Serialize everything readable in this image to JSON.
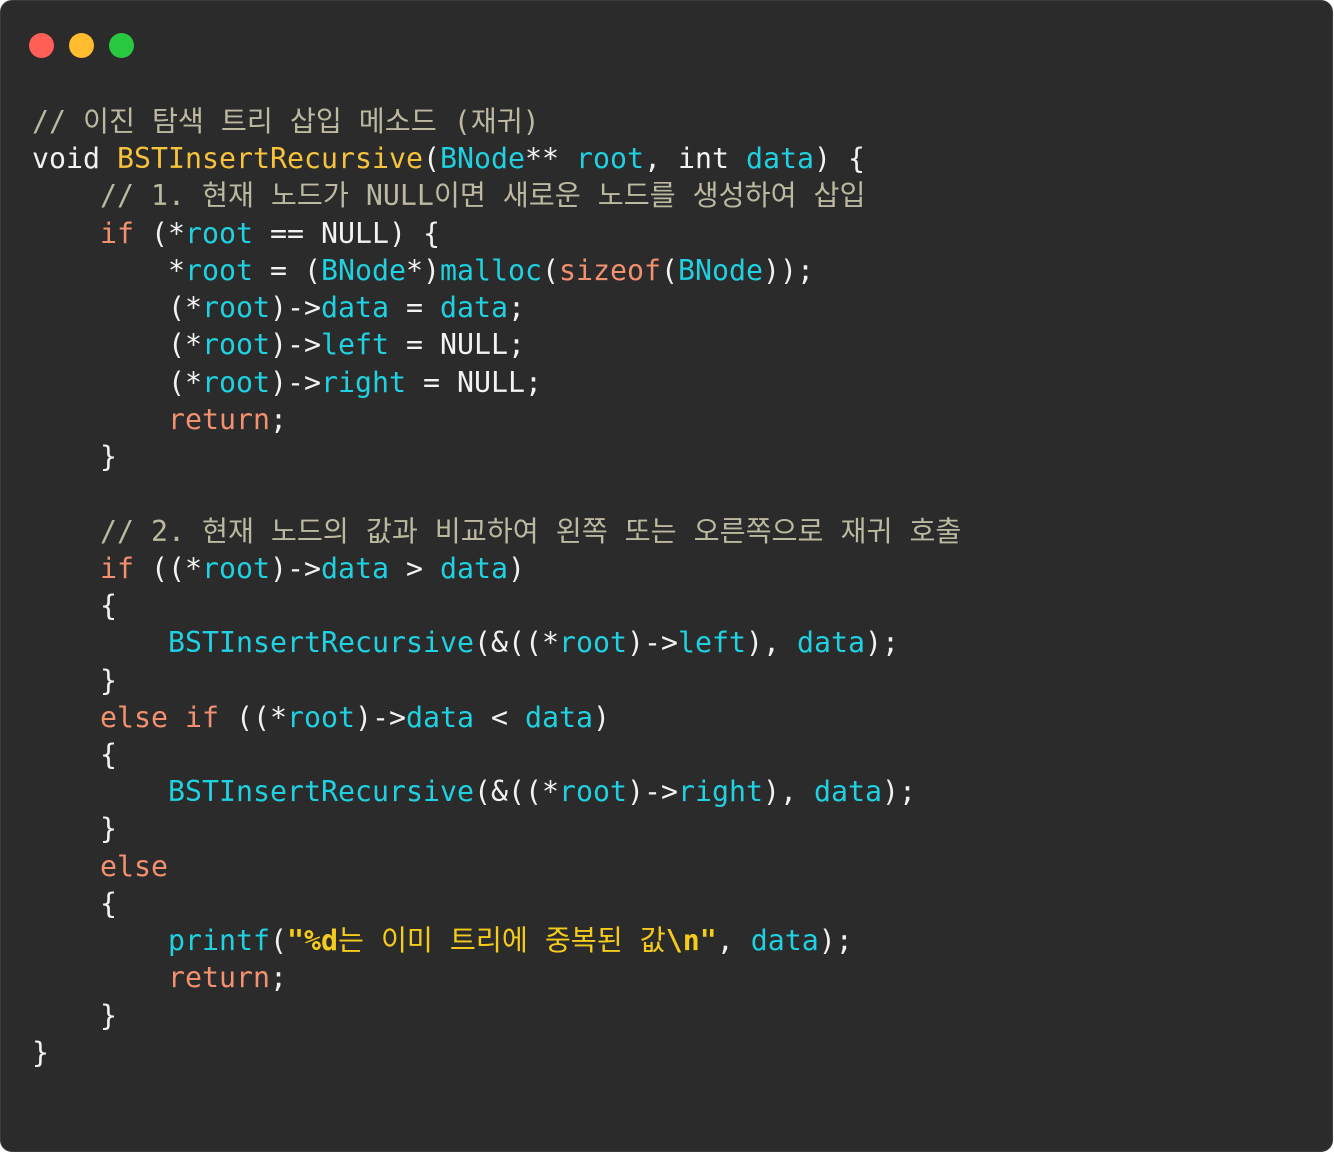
{
  "window": {
    "background": "#2b2b2b",
    "traffic_lights": {
      "close": "#ff5f57",
      "minimize": "#febc2e",
      "zoom": "#28c840"
    }
  },
  "theme": {
    "syntax": {
      "plain": "#f2f2f2",
      "comment": "#bcb9a0",
      "keyword": "#f2906f",
      "function-declaration": "#f7c23c",
      "identifier": "#1fd1e1",
      "string": "#f6cc1c"
    }
  },
  "code": {
    "lines": [
      {
        "tokens": [
          {
            "text": "// 이진 탐색 트리 삽입 메소드 (재귀)",
            "color": "#bcb9a0"
          }
        ]
      },
      {
        "tokens": [
          {
            "text": "void ",
            "color": "#f2f2f2"
          },
          {
            "text": "BSTInsertRecursive",
            "color": "#f7c23c"
          },
          {
            "text": "(",
            "color": "#f2f2f2"
          },
          {
            "text": "BNode",
            "color": "#1fd1e1"
          },
          {
            "text": "** ",
            "color": "#f2f2f2"
          },
          {
            "text": "root",
            "color": "#1fd1e1"
          },
          {
            "text": ", int ",
            "color": "#f2f2f2"
          },
          {
            "text": "data",
            "color": "#1fd1e1"
          },
          {
            "text": ") {",
            "color": "#f2f2f2"
          }
        ]
      },
      {
        "tokens": [
          {
            "text": "    // 1. 현재 노드가 NULL이면 새로운 노드를 생성하여 삽입",
            "color": "#bcb9a0"
          }
        ]
      },
      {
        "tokens": [
          {
            "text": "    if",
            "color": "#f2906f"
          },
          {
            "text": " (*",
            "color": "#f2f2f2"
          },
          {
            "text": "root",
            "color": "#1fd1e1"
          },
          {
            "text": " == NULL) {",
            "color": "#f2f2f2"
          }
        ]
      },
      {
        "tokens": [
          {
            "text": "        *",
            "color": "#f2f2f2"
          },
          {
            "text": "root",
            "color": "#1fd1e1"
          },
          {
            "text": " = (",
            "color": "#f2f2f2"
          },
          {
            "text": "BNode",
            "color": "#1fd1e1"
          },
          {
            "text": "*)",
            "color": "#f2f2f2"
          },
          {
            "text": "malloc",
            "color": "#1fd1e1"
          },
          {
            "text": "(",
            "color": "#f2f2f2"
          },
          {
            "text": "sizeof",
            "color": "#f2906f"
          },
          {
            "text": "(",
            "color": "#f2f2f2"
          },
          {
            "text": "BNode",
            "color": "#1fd1e1"
          },
          {
            "text": "));",
            "color": "#f2f2f2"
          }
        ]
      },
      {
        "tokens": [
          {
            "text": "        (*",
            "color": "#f2f2f2"
          },
          {
            "text": "root",
            "color": "#1fd1e1"
          },
          {
            "text": ")->",
            "color": "#f2f2f2"
          },
          {
            "text": "data",
            "color": "#1fd1e1"
          },
          {
            "text": " = ",
            "color": "#f2f2f2"
          },
          {
            "text": "data",
            "color": "#1fd1e1"
          },
          {
            "text": ";",
            "color": "#f2f2f2"
          }
        ]
      },
      {
        "tokens": [
          {
            "text": "        (*",
            "color": "#f2f2f2"
          },
          {
            "text": "root",
            "color": "#1fd1e1"
          },
          {
            "text": ")->",
            "color": "#f2f2f2"
          },
          {
            "text": "left",
            "color": "#1fd1e1"
          },
          {
            "text": " = NULL;",
            "color": "#f2f2f2"
          }
        ]
      },
      {
        "tokens": [
          {
            "text": "        (*",
            "color": "#f2f2f2"
          },
          {
            "text": "root",
            "color": "#1fd1e1"
          },
          {
            "text": ")->",
            "color": "#f2f2f2"
          },
          {
            "text": "right",
            "color": "#1fd1e1"
          },
          {
            "text": " = NULL;",
            "color": "#f2f2f2"
          }
        ]
      },
      {
        "tokens": [
          {
            "text": "        return",
            "color": "#f2906f"
          },
          {
            "text": ";",
            "color": "#f2f2f2"
          }
        ]
      },
      {
        "tokens": [
          {
            "text": "    }",
            "color": "#f2f2f2"
          }
        ]
      },
      {
        "tokens": []
      },
      {
        "tokens": [
          {
            "text": "    // 2. 현재 노드의 값과 비교하여 왼쪽 또는 오른쪽으로 재귀 호출",
            "color": "#bcb9a0"
          }
        ]
      },
      {
        "tokens": [
          {
            "text": "    if",
            "color": "#f2906f"
          },
          {
            "text": " ((*",
            "color": "#f2f2f2"
          },
          {
            "text": "root",
            "color": "#1fd1e1"
          },
          {
            "text": ")->",
            "color": "#f2f2f2"
          },
          {
            "text": "data",
            "color": "#1fd1e1"
          },
          {
            "text": " > ",
            "color": "#f2f2f2"
          },
          {
            "text": "data",
            "color": "#1fd1e1"
          },
          {
            "text": ")",
            "color": "#f2f2f2"
          }
        ]
      },
      {
        "tokens": [
          {
            "text": "    {",
            "color": "#f2f2f2"
          }
        ]
      },
      {
        "tokens": [
          {
            "text": "        BSTInsertRecursive",
            "color": "#1fd1e1"
          },
          {
            "text": "(&((*",
            "color": "#f2f2f2"
          },
          {
            "text": "root",
            "color": "#1fd1e1"
          },
          {
            "text": ")->",
            "color": "#f2f2f2"
          },
          {
            "text": "left",
            "color": "#1fd1e1"
          },
          {
            "text": "), ",
            "color": "#f2f2f2"
          },
          {
            "text": "data",
            "color": "#1fd1e1"
          },
          {
            "text": ");",
            "color": "#f2f2f2"
          }
        ]
      },
      {
        "tokens": [
          {
            "text": "    }",
            "color": "#f2f2f2"
          }
        ]
      },
      {
        "tokens": [
          {
            "text": "    else if",
            "color": "#f2906f"
          },
          {
            "text": " ((*",
            "color": "#f2f2f2"
          },
          {
            "text": "root",
            "color": "#1fd1e1"
          },
          {
            "text": ")->",
            "color": "#f2f2f2"
          },
          {
            "text": "data",
            "color": "#1fd1e1"
          },
          {
            "text": " < ",
            "color": "#f2f2f2"
          },
          {
            "text": "data",
            "color": "#1fd1e1"
          },
          {
            "text": ")",
            "color": "#f2f2f2"
          }
        ]
      },
      {
        "tokens": [
          {
            "text": "    {",
            "color": "#f2f2f2"
          }
        ]
      },
      {
        "tokens": [
          {
            "text": "        BSTInsertRecursive",
            "color": "#1fd1e1"
          },
          {
            "text": "(&((*",
            "color": "#f2f2f2"
          },
          {
            "text": "root",
            "color": "#1fd1e1"
          },
          {
            "text": ")->",
            "color": "#f2f2f2"
          },
          {
            "text": "right",
            "color": "#1fd1e1"
          },
          {
            "text": "), ",
            "color": "#f2f2f2"
          },
          {
            "text": "data",
            "color": "#1fd1e1"
          },
          {
            "text": ");",
            "color": "#f2f2f2"
          }
        ]
      },
      {
        "tokens": [
          {
            "text": "    }",
            "color": "#f2f2f2"
          }
        ]
      },
      {
        "tokens": [
          {
            "text": "    else",
            "color": "#f2906f"
          }
        ]
      },
      {
        "tokens": [
          {
            "text": "    {",
            "color": "#f2f2f2"
          }
        ]
      },
      {
        "tokens": [
          {
            "text": "        printf",
            "color": "#1fd1e1"
          },
          {
            "text": "(",
            "color": "#f2f2f2"
          },
          {
            "text": "\"%d",
            "color": "#f6cc1c",
            "bold": true
          },
          {
            "text": "는 이미 트리에 중복된 값",
            "color": "#f6cc1c"
          },
          {
            "text": "\\n\"",
            "color": "#f6cc1c",
            "bold": true
          },
          {
            "text": ", ",
            "color": "#f2f2f2"
          },
          {
            "text": "data",
            "color": "#1fd1e1"
          },
          {
            "text": ");",
            "color": "#f2f2f2"
          }
        ]
      },
      {
        "tokens": [
          {
            "text": "        return",
            "color": "#f2906f"
          },
          {
            "text": ";",
            "color": "#f2f2f2"
          }
        ]
      },
      {
        "tokens": [
          {
            "text": "    }",
            "color": "#f2f2f2"
          }
        ]
      },
      {
        "tokens": [
          {
            "text": "}",
            "color": "#f2f2f2"
          }
        ]
      }
    ]
  }
}
